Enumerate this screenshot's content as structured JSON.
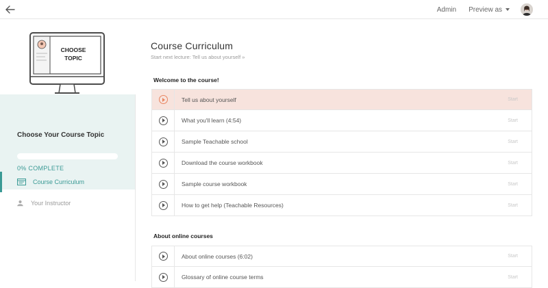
{
  "topbar": {
    "admin_label": "Admin",
    "preview_label": "Preview as"
  },
  "sidebar": {
    "thumbnail_text_line1": "CHOOSE",
    "thumbnail_text_line2": "TOPIC",
    "course_title": "Choose Your Course Topic",
    "progress_percent": 0,
    "progress_label": "0% COMPLETE",
    "nav": [
      {
        "label": "Course Curriculum",
        "icon": "curriculum-icon",
        "active": true
      },
      {
        "label": "Your Instructor",
        "icon": "user-icon",
        "active": false
      }
    ]
  },
  "main": {
    "title": "Course Curriculum",
    "next_lecture": "Start next lecture: Tell us about yourself »",
    "sections": [
      {
        "title": "Welcome to the course!",
        "lectures": [
          {
            "name": "Tell us about yourself",
            "action": "Start",
            "current": true
          },
          {
            "name": "What you'll learn (4:54)",
            "action": "Start"
          },
          {
            "name": "Sample Teachable school",
            "action": "Start"
          },
          {
            "name": "Download the course workbook",
            "action": "Start"
          },
          {
            "name": "Sample course workbook",
            "action": "Start"
          },
          {
            "name": "How to get help (Teachable Resources)",
            "action": "Start"
          }
        ]
      },
      {
        "title": "About online courses",
        "lectures": [
          {
            "name": "About online courses (6:02)",
            "action": "Start"
          },
          {
            "name": "Glossary of online course terms",
            "action": "Start"
          }
        ]
      }
    ]
  },
  "colors": {
    "accent": "#3a9a95",
    "current_row": "#f7e3dd",
    "current_icon": "#e8845f",
    "sidebar_panel": "#e9f3f2"
  }
}
